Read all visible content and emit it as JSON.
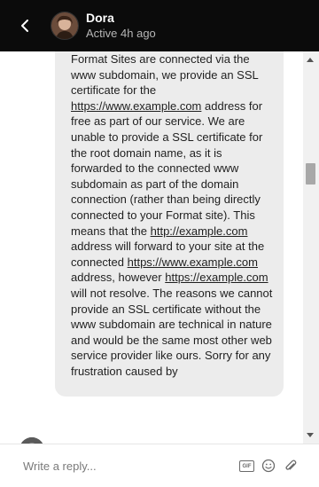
{
  "header": {
    "contact_name": "Dora",
    "status": "Active 4h ago"
  },
  "message": {
    "segments": [
      {
        "text": "Format Sites are connected via the ",
        "link": false
      },
      {
        "text": "www",
        "link": false
      },
      {
        "text": " subdomain, we provide an SSL certificate for the ",
        "link": false
      },
      {
        "text": "https://www.example.com",
        "link": true
      },
      {
        "text": " address for free as part of our service. We are unable to provide a SSL certificate for the root domain name, as it is forwarded to the connected www subdomain as part of the domain connection (rather than being directly connected to your Format site). This means that the ",
        "link": false
      },
      {
        "text": "http://example.com",
        "link": true
      },
      {
        "text": " address will forward to your site at the connected ",
        "link": false
      },
      {
        "text": "https://www.example.com",
        "link": true
      },
      {
        "text": " address, however ",
        "link": false
      },
      {
        "text": "https://example.com",
        "link": true
      },
      {
        "text": " will not resolve. The reasons we cannot provide an SSL certificate without the www subdomain are technical in nature and would be the same most other web service provider like ours. Sorry for any frustration caused by",
        "link": false
      }
    ]
  },
  "composer": {
    "placeholder": "Write a reply...",
    "gif_label": "GIF"
  },
  "icons": {
    "back": "chevron-left-icon",
    "gif": "gif-icon",
    "emoji": "emoji-icon",
    "attach": "paperclip-icon"
  }
}
